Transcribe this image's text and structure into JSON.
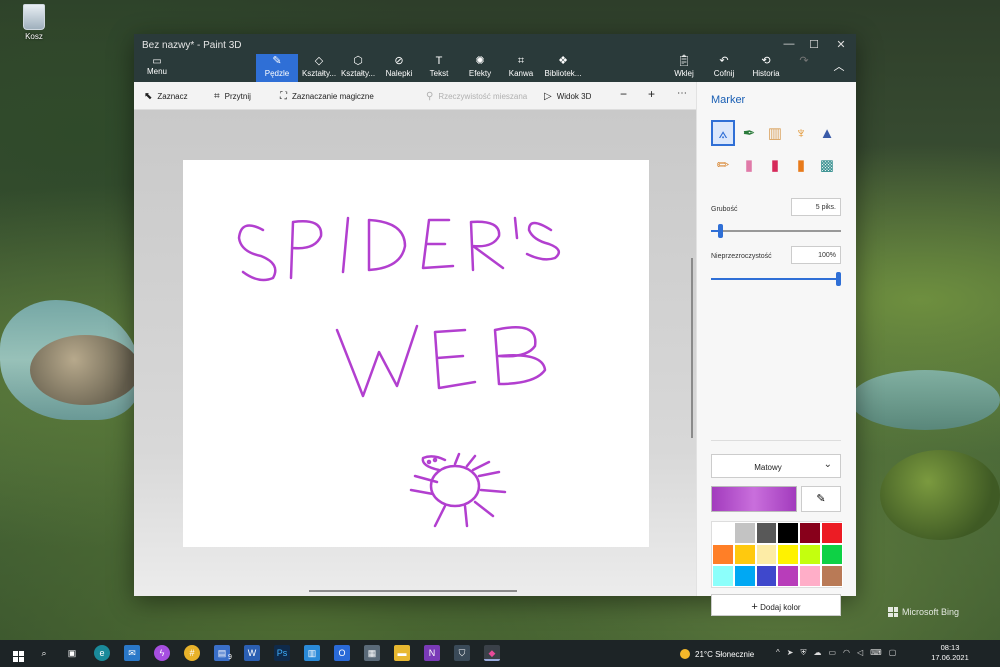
{
  "desktop": {
    "recycle_bin_label": "Kosz",
    "bing_watermark": "Microsoft Bing"
  },
  "window": {
    "title": "Bez nazwy* - Paint 3D",
    "menu_label": "Menu",
    "tools": [
      {
        "label": "Pędzle",
        "icon": "brush-icon"
      },
      {
        "label": "Kształty...",
        "icon": "2d-shapes-icon"
      },
      {
        "label": "Kształty...",
        "icon": "3d-shapes-icon"
      },
      {
        "label": "Nalepki",
        "icon": "sticker-icon"
      },
      {
        "label": "Tekst",
        "icon": "text-icon"
      },
      {
        "label": "Efekty",
        "icon": "effects-icon"
      },
      {
        "label": "Kanwa",
        "icon": "canvas-icon"
      },
      {
        "label": "Bibliotek...",
        "icon": "library-icon"
      }
    ],
    "right_tools": [
      {
        "label": "Wklej",
        "icon": "paste-icon"
      },
      {
        "label": "Cofnij",
        "icon": "undo-icon"
      },
      {
        "label": "Historia",
        "icon": "history-icon"
      }
    ]
  },
  "toolbar2": {
    "select": "Zaznacz",
    "crop": "Przytnij",
    "magic_select": "Zaznaczanie magiczne",
    "mixed_reality": "Rzeczywistość mieszana",
    "view_3d": "Widok 3D"
  },
  "canvas": {
    "stroke_color": "#b23fcf",
    "drawing_words": [
      "SPIDER'S",
      "WEB"
    ]
  },
  "panel": {
    "title": "Marker",
    "thickness_label": "Grubość",
    "thickness_value": "5 piks.",
    "thickness_fraction": 0.05,
    "opacity_label": "Nieprzezroczystość",
    "opacity_value": "100%",
    "opacity_fraction": 1.0,
    "finish": "Matowy",
    "add_color": "Dodaj kolor",
    "current_color": "#a23bbd",
    "palette": [
      "#ffffff",
      "#c3c3c3",
      "#585858",
      "#000000",
      "#88001b",
      "#ec1c24",
      "#ff7f27",
      "#ffc90e",
      "#fdeca6",
      "#fff200",
      "#c4ff0e",
      "#0ed145",
      "#8cfffb",
      "#00a8f3",
      "#3f48cc",
      "#b83dba",
      "#ffaec8",
      "#b97a56"
    ]
  },
  "taskbar": {
    "weather": "21°C  Słonecznie",
    "time": "08:13",
    "date": "17.06.2021",
    "word_badge": "9"
  }
}
